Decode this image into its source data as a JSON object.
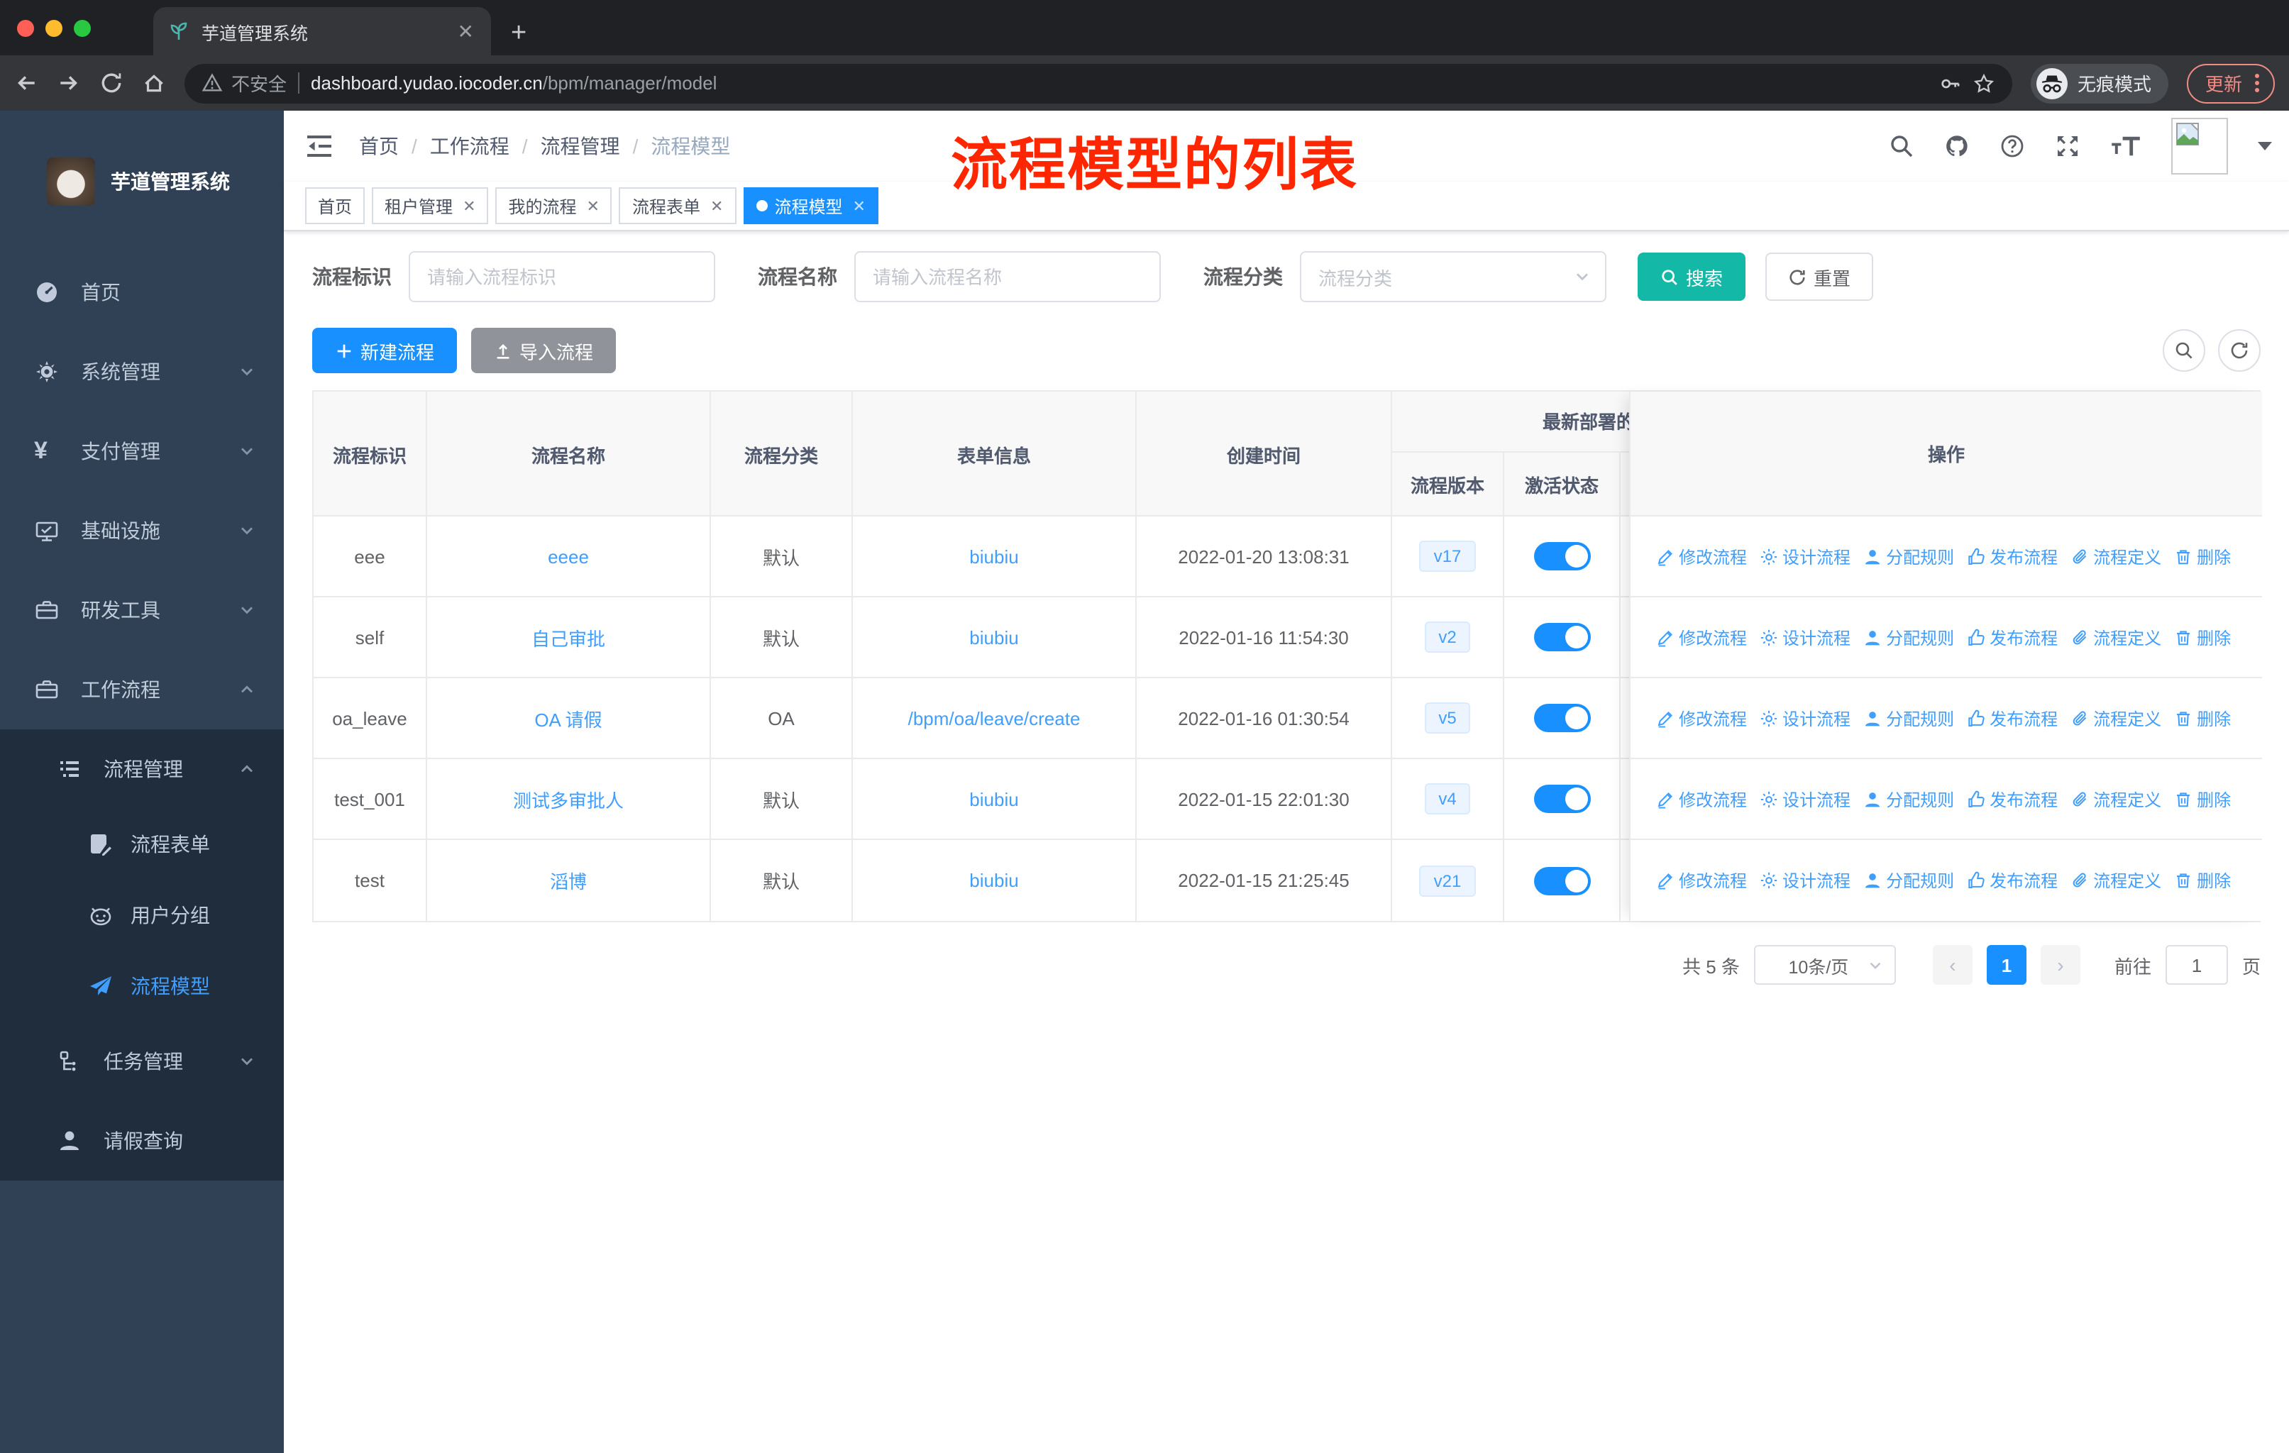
{
  "browser": {
    "tab_title": "芋道管理系统",
    "security_label": "不安全",
    "url_host": "dashboard.yudao.iocoder.cn",
    "url_path": "/bpm/manager/model",
    "incognito_label": "无痕模式",
    "update_label": "更新"
  },
  "sidebar": {
    "logo_title": "芋道管理系统",
    "menu": {
      "home": "首页",
      "system": "系统管理",
      "payment": "支付管理",
      "infra": "基础设施",
      "dev_tools": "研发工具",
      "workflow": "工作流程",
      "process_mgmt": "流程管理",
      "process_form": "流程表单",
      "user_group": "用户分组",
      "process_model": "流程模型",
      "task_mgmt": "任务管理",
      "leave_query": "请假查询"
    }
  },
  "header": {
    "breadcrumb": [
      "首页",
      "工作流程",
      "流程管理",
      "流程模型"
    ],
    "annotation": "流程模型的列表"
  },
  "tags": [
    {
      "label": "首页",
      "closable": false,
      "active": false
    },
    {
      "label": "租户管理",
      "closable": true,
      "active": false
    },
    {
      "label": "我的流程",
      "closable": true,
      "active": false
    },
    {
      "label": "流程表单",
      "closable": true,
      "active": false
    },
    {
      "label": "流程模型",
      "closable": true,
      "active": true
    }
  ],
  "filters": {
    "key_label": "流程标识",
    "key_placeholder": "请输入流程标识",
    "name_label": "流程名称",
    "name_placeholder": "请输入流程名称",
    "category_label": "流程分类",
    "category_placeholder": "流程分类",
    "search_label": "搜索",
    "reset_label": "重置"
  },
  "toolbar": {
    "create_label": "新建流程",
    "import_label": "导入流程"
  },
  "table": {
    "headers": {
      "key": "流程标识",
      "name": "流程名称",
      "category": "流程分类",
      "form": "表单信息",
      "create_time": "创建时间",
      "deploy_group": "最新部署的",
      "version": "流程版本",
      "active_status": "激活状态",
      "actions": "操作"
    },
    "actions": [
      {
        "icon": "edit-icon",
        "label": "修改流程"
      },
      {
        "icon": "design-icon",
        "label": "设计流程"
      },
      {
        "icon": "assign-icon",
        "label": "分配规则"
      },
      {
        "icon": "publish-icon",
        "label": "发布流程"
      },
      {
        "icon": "definition-icon",
        "label": "流程定义"
      },
      {
        "icon": "delete-icon",
        "label": "删除"
      }
    ],
    "rows": [
      {
        "key": "eee",
        "name": "eeee",
        "category": "默认",
        "form": "biubiu",
        "create_time": "2022-01-20 13:08:31",
        "version": "v17",
        "active": true
      },
      {
        "key": "self",
        "name": "自己审批",
        "category": "默认",
        "form": "biubiu",
        "create_time": "2022-01-16 11:54:30",
        "version": "v2",
        "active": true
      },
      {
        "key": "oa_leave",
        "name": "OA 请假",
        "category": "OA",
        "form": "/bpm/oa/leave/create",
        "create_time": "2022-01-16 01:30:54",
        "version": "v5",
        "active": true
      },
      {
        "key": "test_001",
        "name": "测试多审批人",
        "category": "默认",
        "form": "biubiu",
        "create_time": "2022-01-15 22:01:30",
        "version": "v4",
        "active": true
      },
      {
        "key": "test",
        "name": "滔博",
        "category": "默认",
        "form": "biubiu",
        "create_time": "2022-01-15 21:25:45",
        "version": "v21",
        "active": true
      }
    ]
  },
  "pagination": {
    "total_label": "共 5 条",
    "page_size": "10条/页",
    "current_page": "1",
    "goto_label": "前往",
    "goto_value": "1",
    "page_unit": "页"
  },
  "colors": {
    "primary_blue": "#1890ff",
    "link_blue": "#409eff",
    "search_teal": "#14b8a6",
    "sidebar_bg": "#304156",
    "submenu_bg": "#1f2d3d",
    "annotation_red": "#ff2600",
    "update_salmon": "#f28b82"
  }
}
